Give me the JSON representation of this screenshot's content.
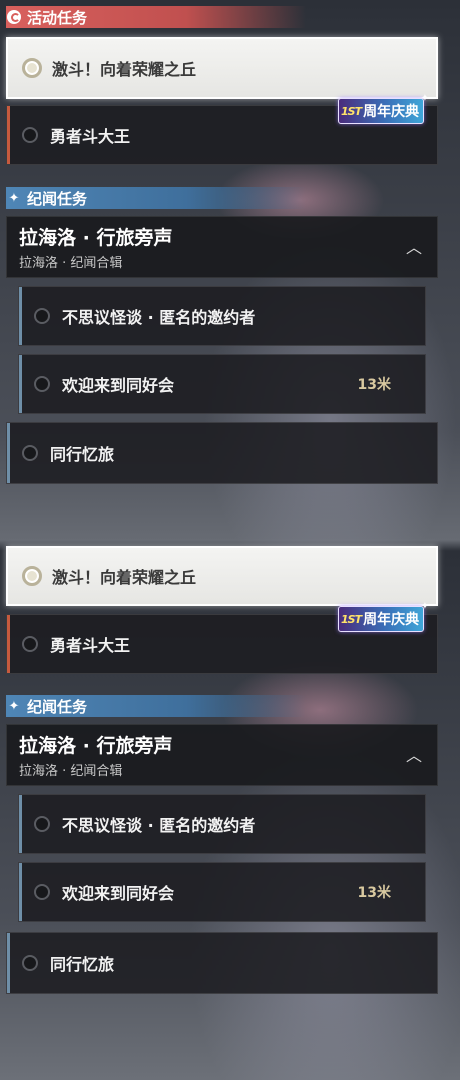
{
  "panels": [
    {
      "activity_header": "活动任务",
      "active_quest": "激斗！向着荣耀之丘",
      "second_quest": "勇者斗大王",
      "badge_icon_text": "1ST",
      "badge_label": "周年庆典",
      "chronicle_header": "纪闻任务",
      "group_title": "拉海洛 · 行旅旁声",
      "group_subtitle": "拉海洛 · 纪闻合辑",
      "subquests": [
        {
          "label": "不思议怪谈 · 匿名的邀约者",
          "distance": ""
        },
        {
          "label": "欢迎来到同好会",
          "distance": "13米"
        }
      ],
      "standalone_quest": "同行忆旅"
    },
    {
      "activity_header": "",
      "active_quest": "激斗！向着荣耀之丘",
      "second_quest": "勇者斗大王",
      "badge_icon_text": "1ST",
      "badge_label": "周年庆典",
      "chronicle_header": "纪闻任务",
      "group_title": "拉海洛 · 行旅旁声",
      "group_subtitle": "拉海洛 · 纪闻合辑",
      "subquests": [
        {
          "label": "不思议怪谈 · 匿名的邀约者",
          "distance": ""
        },
        {
          "label": "欢迎来到同好会",
          "distance": "13米"
        }
      ],
      "standalone_quest": "同行忆旅"
    }
  ],
  "colors": {
    "activity_accent": "#d9605d",
    "chronicle_accent": "#4f86b6",
    "distance_text": "#d9c9a0",
    "active_card_bg": "#f0f0ee"
  },
  "icons": {
    "activity_header": "restart-icon",
    "chronicle_header": "sparkle-icon",
    "group_toggle": "chevron-up-icon",
    "quest_marker": "radio-circle-icon"
  }
}
